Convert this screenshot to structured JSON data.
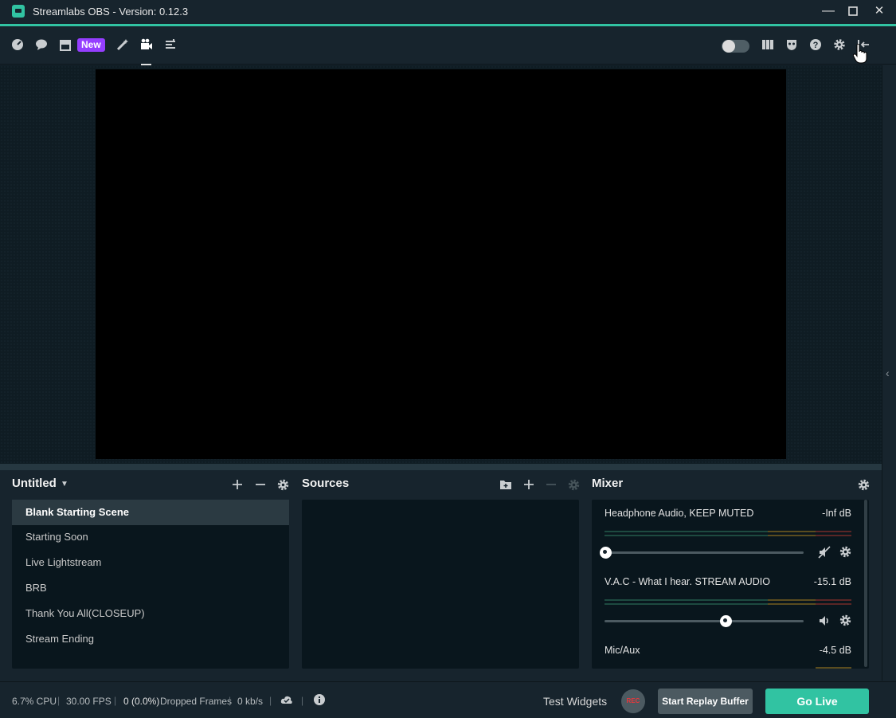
{
  "window": {
    "title": "Streamlabs OBS - Version: 0.12.3",
    "minimize": "—",
    "maximize": "☐",
    "close": "✕"
  },
  "topnav": {
    "new_badge": "New",
    "left_icons": [
      "dashboard-icon",
      "chat-icon",
      "store-icon",
      "themes-icon",
      "studio-icon",
      "layout-editor-icon"
    ],
    "right_icons": [
      "studio-mode-toggle",
      "columns-icon",
      "mask-icon",
      "help-icon",
      "settings-icon",
      "collapse-icon"
    ]
  },
  "scenes": {
    "collection": "Untitled",
    "items": [
      "Blank Starting Scene",
      "Starting Soon",
      "Live Lightstream",
      "BRB",
      "Thank You All(CLOSEUP)",
      "Stream Ending"
    ],
    "selected_index": 0
  },
  "sources": {
    "title": "Sources"
  },
  "mixer": {
    "title": "Mixer",
    "channels": [
      {
        "name": "Headphone Audio, KEEP MUTED",
        "db": "-Inf dB",
        "volume": 0.0,
        "muted": true
      },
      {
        "name": "V.A.C - What I hear. STREAM AUDIO",
        "db": "-15.1 dB",
        "volume": 0.61,
        "muted": false
      },
      {
        "name": "Mic/Aux",
        "db": "-4.5 dB"
      }
    ]
  },
  "footer": {
    "cpu": "6.7% CPU",
    "fps": "30.00 FPS",
    "dropped_count": "0 (0.0%)",
    "dropped_label": "Dropped Frames",
    "bitrate": "0 kb/s",
    "test_widgets": "Test Widgets",
    "rec": "REC",
    "replay": "Start Replay Buffer",
    "go_live": "Go Live"
  },
  "colors": {
    "accent": "#31c3a2",
    "new_badge": "#953eff",
    "rec_text": "#e6383c"
  }
}
